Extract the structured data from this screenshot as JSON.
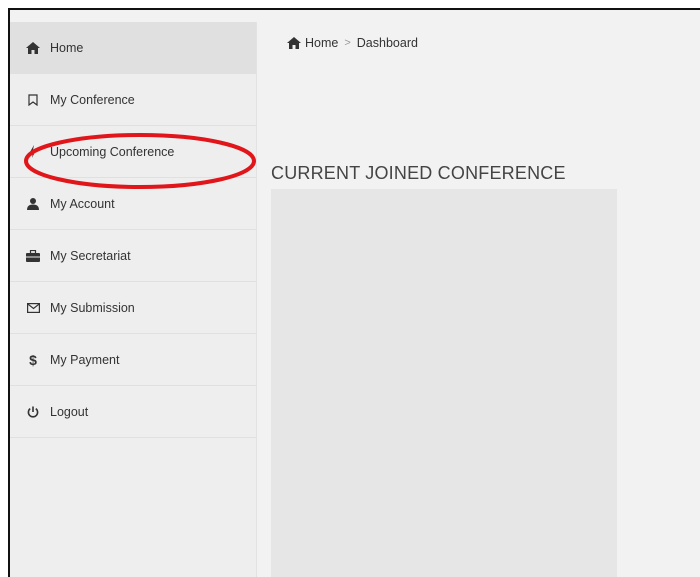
{
  "breadcrumb": {
    "home_label": "Home",
    "separator": ">",
    "current_label": "Dashboard"
  },
  "sidebar": {
    "items": [
      {
        "label": "Home",
        "icon": "home-icon",
        "active": true
      },
      {
        "label": "My Conference",
        "icon": "bookmark-icon",
        "active": false
      },
      {
        "label": "Upcoming Conference",
        "icon": "bolt-icon",
        "active": false
      },
      {
        "label": "My Account",
        "icon": "user-icon",
        "active": false
      },
      {
        "label": "My Secretariat",
        "icon": "briefcase-icon",
        "active": false
      },
      {
        "label": "My Submission",
        "icon": "envelope-icon",
        "active": false
      },
      {
        "label": "My Payment",
        "icon": "dollar-icon",
        "active": false
      },
      {
        "label": "Logout",
        "icon": "power-icon",
        "active": false
      }
    ]
  },
  "main": {
    "section_title": "CURRENT JOINED CONFERENCE"
  },
  "annotation": {
    "color": "#e0161b"
  }
}
